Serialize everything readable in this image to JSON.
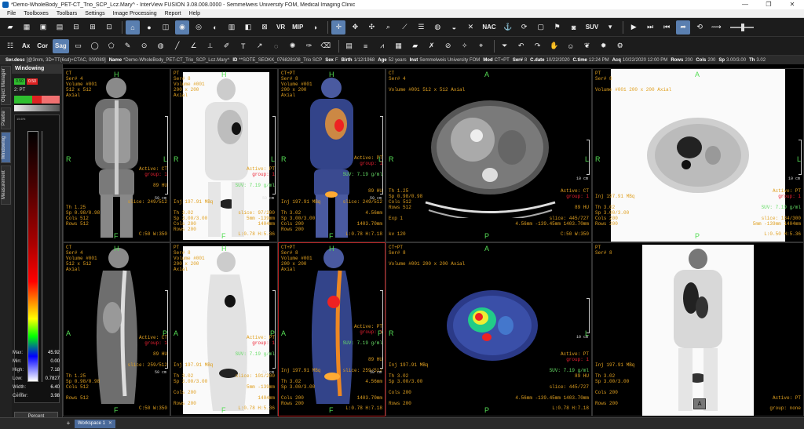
{
  "window": {
    "title": "*Demo-WholeBody_PET-CT_Trio_SCP_Lcz.Mary^ - InterView FUSION 3.08.008.0000 - Semmelweis University FOM, Medical Imaging Clinic",
    "minimize": "—",
    "maximize": "❐",
    "close": "✕"
  },
  "menu": [
    "File",
    "Toolboxes",
    "Toolbars",
    "Settings",
    "Image Processing",
    "Report",
    "Help"
  ],
  "toolbar1": {
    "buttons": [
      "✥",
      "✋",
      "▢",
      "⬚",
      "◉",
      "✚",
      "◎",
      "▤",
      "⊡",
      "⊟",
      "▣",
      "▦",
      "◫",
      "⊞",
      "⊞",
      "⊠",
      "◧",
      "▥",
      "⊗"
    ],
    "labels": {
      "vr": "VR",
      "mip": "MIP",
      "nac": "NAC",
      "suv": "SUV"
    }
  },
  "toolbar2": {
    "views": [
      "Ax",
      "Cor",
      "Sag"
    ]
  },
  "infostrip": [
    {
      "k": "Ser.desc",
      "v": "[@3mm, 3D+TT(6sd)+CTAC, 000089]"
    },
    {
      "k": "Name",
      "v": "*Demo-WholeBody_PET-CT_Trio_SCP_Lcz.Mary^"
    },
    {
      "k": "ID",
      "v": "**SOTE_SEOKK_076828108_Trio SCP"
    },
    {
      "k": "Sex",
      "v": "F"
    },
    {
      "k": "Birth",
      "v": "1/12/1968"
    },
    {
      "k": "Age",
      "v": "52 years"
    },
    {
      "k": "Inst",
      "v": "Semmelweis University FOM"
    },
    {
      "k": "Mod",
      "v": "CT+PT"
    },
    {
      "k": "Ser#",
      "v": "8"
    },
    {
      "k": "C.date",
      "v": "10/22/2020"
    },
    {
      "k": "C.time",
      "v": "12:24 PM"
    },
    {
      "k": "Acq",
      "v": "10/22/2020 12:00 PM"
    },
    {
      "k": "Rows",
      "v": "200"
    },
    {
      "k": "Cols",
      "v": "200"
    },
    {
      "k": "Sp",
      "v": "3.00/3.00"
    },
    {
      "k": "Th",
      "v": "3.02"
    }
  ],
  "sidetabs": [
    "Object Manager",
    "Palette",
    "Windowing",
    "Measurement"
  ],
  "windowing": {
    "title": "Windowing",
    "btn1": "0.50",
    "btn2": "0.50",
    "layer": "2: PT",
    "scale_top": "15.6%",
    "scale_bot": "2.9%",
    "stats": [
      {
        "k": "Max:",
        "v": "45.92"
      },
      {
        "k": "Min:",
        "v": "0.00"
      },
      {
        "k": "High:",
        "v": "7.18"
      },
      {
        "k": "Low:",
        "v": "0.7827"
      },
      {
        "k": "Width:",
        "v": "6.40"
      },
      {
        "k": "Center:",
        "v": "3.98"
      }
    ],
    "percent": "Percent"
  },
  "viewports": [
    {
      "mod": "CT",
      "ser": "Ser# 4",
      "vol": "Volume #001",
      "dim": "512 x 512",
      "plane": "Axial",
      "active": "Active: CT",
      "group": "group: 1",
      "val": "89 HU",
      "th": "Th 1.25",
      "sp": "Sp 0.98/0.98",
      "cols": "Cols 512",
      "rows": "Rows 512",
      "slice": "slice: 249/512",
      "mm": "4.56mm",
      "wl": "C:50 W:350",
      "scale": "50 cm"
    },
    {
      "mod": "PT",
      "ser": "Ser# 8",
      "vol": "Volume #001",
      "dim": "200 x 200",
      "plane": "Axial",
      "active": "Active: PT",
      "group": "group: 1",
      "suv": "SUV: 7.19 g/ml",
      "inj": "Inj 197.91 MBq",
      "th": "Th 3.02",
      "sp": "Sp 3.00/3.00",
      "cols": "Cols 200",
      "rows": "Rows 200",
      "slice": "slice: 97/200",
      "mm": "5mm -139mm",
      "mm2": "1404mm",
      "wl": "L:0.78 H:5.36",
      "scale": "50 cm"
    },
    {
      "mod": "CT+PT",
      "ser": "Ser# 8",
      "vol": "Volume #001",
      "dim": "200 x 200",
      "plane": "Axial",
      "active": "Active: PT",
      "group": "group: 1",
      "suv": "SUV: 7.19 g/ml",
      "val": "89 HU",
      "inj": "Inj 197.91 MBq",
      "th": "Th 3.02",
      "sp": "Sp 3.00/3.00",
      "cols": "Cols 200",
      "rows": "Rows 200",
      "slice": "slice: 249/512",
      "mm": "4.56mm",
      "mm2": "1403.70mm",
      "wl": "L:0.78 H:7.18",
      "scale": "50 cm"
    },
    {
      "mod": "CT",
      "ser": "Ser# 4",
      "vol": "Volume #001 512 x 512 Axial",
      "active": "Active: CT",
      "group": "group: 1",
      "val": "89 HU",
      "th": "Th 1.25",
      "sp": "Sp 0.98/0.98",
      "cols": "Cols 512",
      "rows": "Rows 512",
      "exp": "Exp 1",
      "kv": "kv 120",
      "slice": "slice: 445/727",
      "mm": "4.56mm -139.45mm 1403.70mm",
      "wl": "C:50 W:350",
      "scale": "10 cm"
    },
    {
      "mod": "PT",
      "ser": "Ser# 8",
      "vol": "Volume #001 200 x 200 Axial",
      "active": "Active: PT",
      "group": "group: 1",
      "suv": "SUV: 7.19 g/ml",
      "inj": "Inj 197.91 MBq",
      "th": "Th 3.02",
      "sp": "Sp 3.00/3.00",
      "cols": "Cols 200",
      "rows": "Rows 200",
      "slice": "slice: 184/300",
      "mm": "5mm -139mm 1404mm",
      "wl": "L:0.50 H:5.36",
      "scale": "10 cm"
    },
    {
      "mod": "CT",
      "ser": "Ser# 4",
      "vol": "Volume #001",
      "dim": "512 x 512",
      "plane": "Axial",
      "active": "Active: CT",
      "group": "group: 1",
      "val": "89 HU",
      "th": "Th 1.25",
      "sp": "Sp 0.98/0.98",
      "cols": "Cols 512",
      "rows": "Rows 512",
      "slice": "slice: 259/512",
      "mm": "4.56mm",
      "wl": "C:50 W:350",
      "scale": "50 cm"
    },
    {
      "mod": "PT",
      "ser": "Ser# 8",
      "vol": "Volume #001",
      "dim": "200 x 200",
      "plane": "Axial",
      "active": "Active: PT",
      "group": "group: 1",
      "suv": "SUV: 7.19 g/ml",
      "inj": "Inj 197.91 MBq",
      "th": "Th 3.02",
      "sp": "Sp 3.00/3.00",
      "cols": "Cols 200",
      "rows": "Rows 200",
      "slice": "slice: 101/200",
      "mm": "5mm -139mm",
      "mm2": "1404mm",
      "wl": "L:0.78 H:5.36",
      "scale": "50 cm"
    },
    {
      "mod": "CT+PT",
      "ser": "Ser# 8",
      "vol": "Volume #001",
      "dim": "200 x 200",
      "plane": "Axial",
      "active": "Active: PT",
      "group": "group: 1",
      "suv": "SUV: 7.19 g/ml",
      "val": "89 HU",
      "inj": "Inj 197.91 MBq",
      "th": "Th 3.02",
      "sp": "Sp 3.00/3.00",
      "cols": "Cols 200",
      "rows": "Rows 200",
      "slice": "slice: 259/512",
      "mm": "4.56mm",
      "mm2": "1403.70mm",
      "wl": "L:0.78 H:7.18",
      "scale": "50 cm"
    },
    {
      "mod": "CT+PT",
      "ser": "Ser# 8",
      "vol": "Volume #001 200 x 200 Axial",
      "active": "Active: PT",
      "group": "group: 1",
      "suv": "SUV: 7.19 g/ml",
      "val": "89 HU",
      "inj": "Inj 197.91 MBq",
      "th": "Th 3.02",
      "sp": "Sp 3.00/3.00",
      "cols": "Cols 200",
      "rows": "Rows 200",
      "slice": "slice: 445/727",
      "mm": "4.56mm -139.45mm 1403.70mm",
      "wl": "L:0.78 H:7.18",
      "scale": "10 cm"
    },
    {
      "mod": "PT",
      "ser": "Ser# 8",
      "active": "Active: PT",
      "group": "group: none",
      "inj": "Inj 197.91 MBq",
      "th": "Th 3.02",
      "sp": "Sp 3.00/3.00",
      "cols": "Cols 200",
      "rows": "Rows 200",
      "mm": "",
      "abtn": "A"
    }
  ],
  "orient": {
    "A": "A",
    "P": "P",
    "R": "R",
    "L": "L",
    "H": "H",
    "F": "F"
  },
  "workspace_tab": "Workspace 1",
  "tab_add": "+",
  "tab_close": "✕"
}
